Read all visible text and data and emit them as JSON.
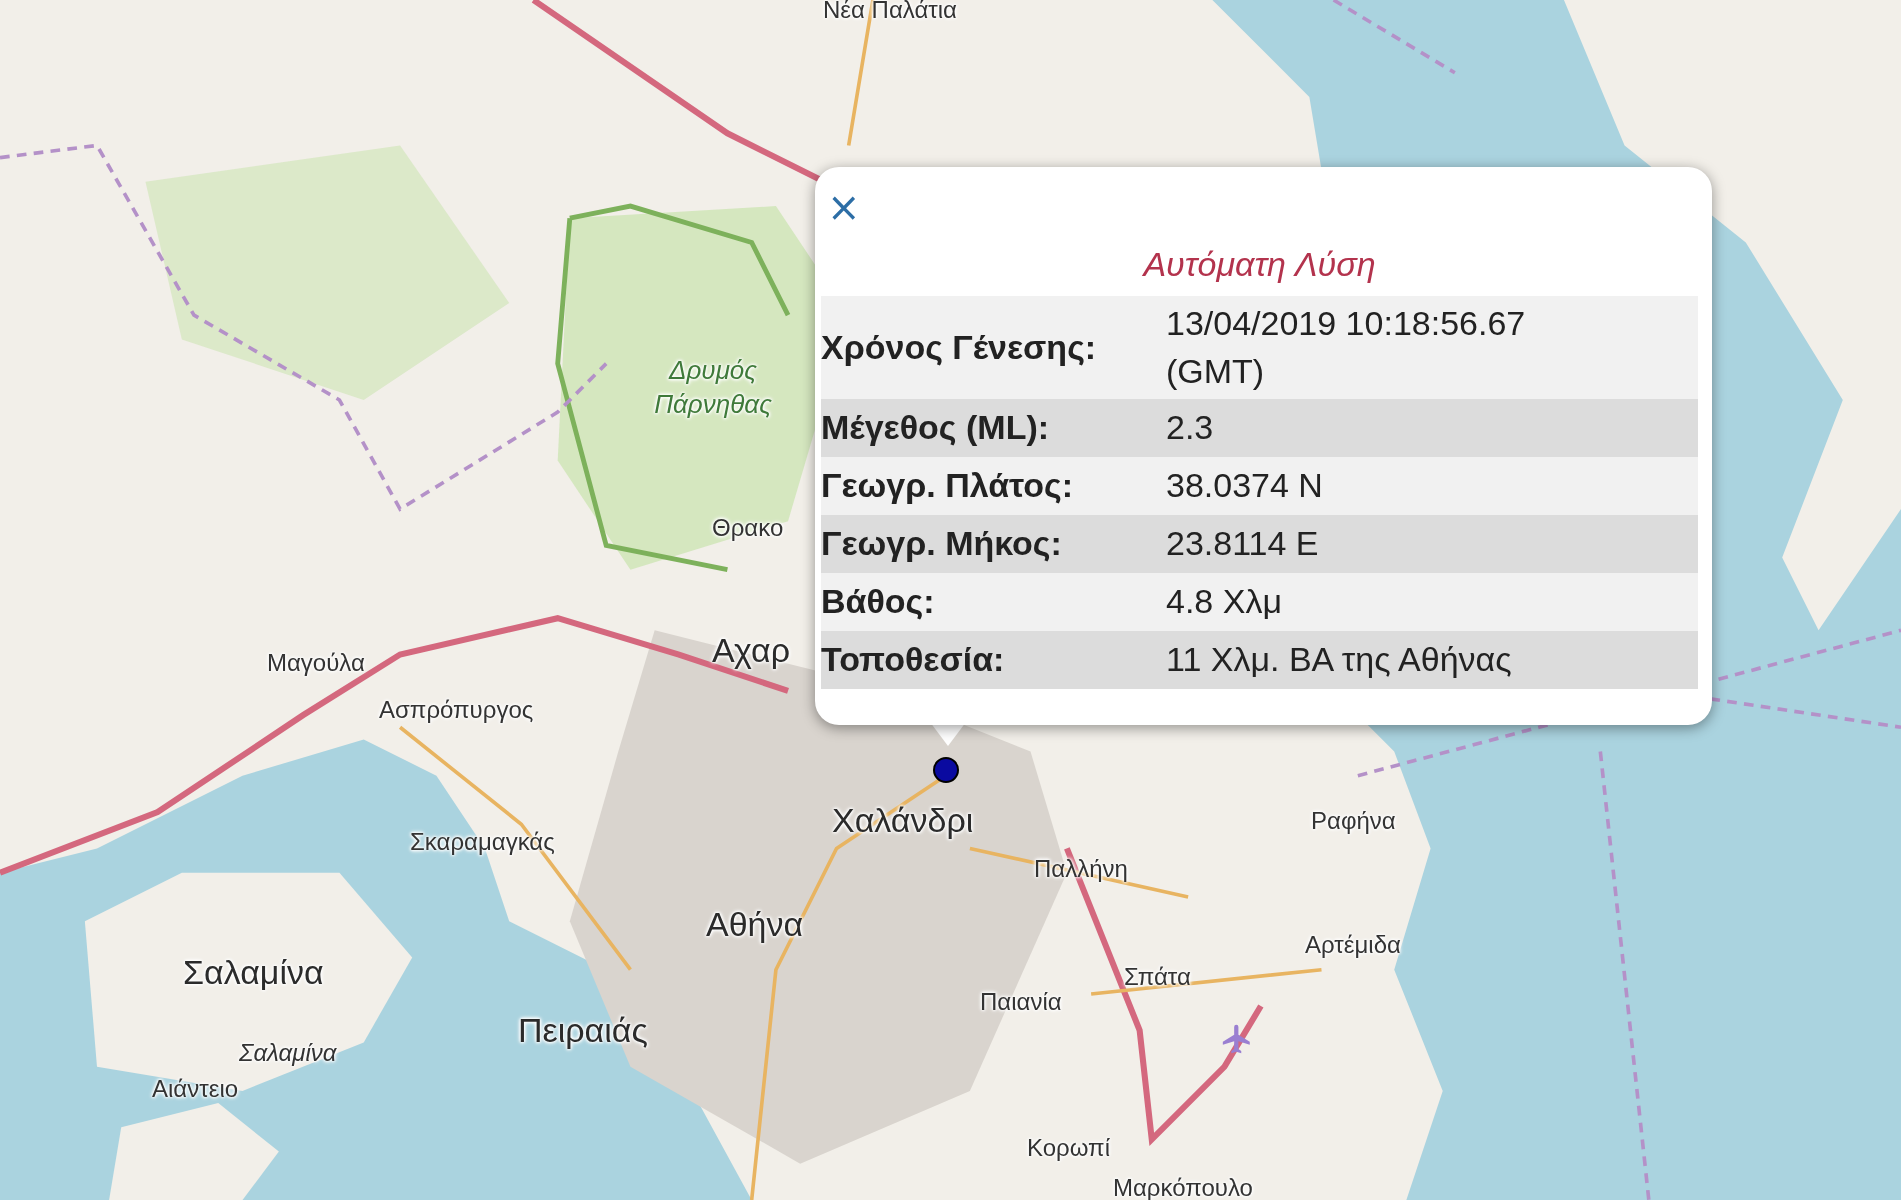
{
  "map_labels": [
    {
      "text": "Νέα Παλάτια",
      "kind": "town"
    },
    {
      "text": "Δρυμός Πάρνηθας",
      "kind": "park"
    },
    {
      "text": "Θρακο",
      "kind": "town"
    },
    {
      "text": "Αχαρ",
      "kind": "city"
    },
    {
      "text": "Μαγούλα",
      "kind": "town"
    },
    {
      "text": "Ασπρόπυργος",
      "kind": "town"
    },
    {
      "text": "Χαλάνδρι",
      "kind": "city"
    },
    {
      "text": "Ραφήνα",
      "kind": "town"
    },
    {
      "text": "Σκαραμαγκάς",
      "kind": "town"
    },
    {
      "text": "Παλλήνη",
      "kind": "town"
    },
    {
      "text": "Αθήνα",
      "kind": "city"
    },
    {
      "text": "Αρτέμιδα",
      "kind": "town"
    },
    {
      "text": "Σαλαμίνα",
      "kind": "city"
    },
    {
      "text": "Σπάτα",
      "kind": "town"
    },
    {
      "text": "Παιανία",
      "kind": "town"
    },
    {
      "text": "Πειραιάς",
      "kind": "city"
    },
    {
      "text": "Σαλαμίνα",
      "kind": "island"
    },
    {
      "text": "Αιάντειο",
      "kind": "town"
    },
    {
      "text": "Κορωπί",
      "kind": "town"
    },
    {
      "text": "Μαρκόπουλο",
      "kind": "town"
    }
  ],
  "popup": {
    "close": "×",
    "title": "Αυτόματη Λύση",
    "rows": [
      {
        "label": "Χρόνος Γένεσης:",
        "value": "13/04/2019 10:18:56.67 (GMT)"
      },
      {
        "label": "Μέγεθος (ML):",
        "value": "2.3"
      },
      {
        "label": "Γεωγρ. Πλάτος:",
        "value": "38.0374 N"
      },
      {
        "label": "Γεωγρ. Μήκος:",
        "value": "23.8114 E"
      },
      {
        "label": "Βάθος:",
        "value": "4.8 Χλμ"
      },
      {
        "label": "Τοποθεσία:",
        "value": "11 Χλμ. ΒΑ της Αθήνας"
      }
    ]
  }
}
